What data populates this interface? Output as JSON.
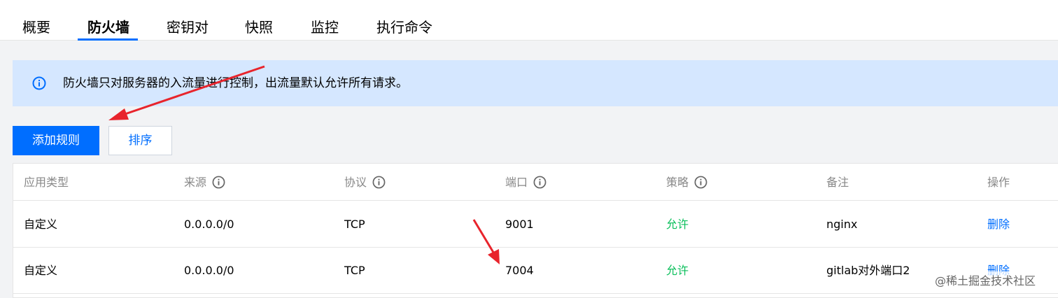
{
  "tabs": [
    {
      "label": "概要",
      "active": false
    },
    {
      "label": "防火墙",
      "active": true
    },
    {
      "label": "密钥对",
      "active": false
    },
    {
      "label": "快照",
      "active": false
    },
    {
      "label": "监控",
      "active": false
    },
    {
      "label": "执行命令",
      "active": false
    }
  ],
  "notice": {
    "icon": "info-circle-icon",
    "text": "防火墙只对服务器的入流量进行控制，出流量默认允许所有请求。"
  },
  "toolbar": {
    "add_label": "添加规则",
    "sort_label": "排序"
  },
  "table": {
    "columns": [
      "应用类型",
      "来源",
      "协议",
      "端口",
      "策略",
      "备注",
      "操作"
    ],
    "rows": [
      {
        "type": "自定义",
        "source": "0.0.0.0/0",
        "protocol": "TCP",
        "port": "9001",
        "policy": "允许",
        "remark": "nginx",
        "action": "删除"
      },
      {
        "type": "自定义",
        "source": "0.0.0.0/0",
        "protocol": "TCP",
        "port": "7004",
        "policy": "允许",
        "remark": "gitlab对外端口2",
        "action": "删除"
      }
    ]
  },
  "watermark": "@稀土掘金技术社区",
  "colors": {
    "accent": "#006eff",
    "notice_bg": "#d5e7ff",
    "allow": "#0abf5b",
    "annotation_arrow": "#e8242c"
  }
}
